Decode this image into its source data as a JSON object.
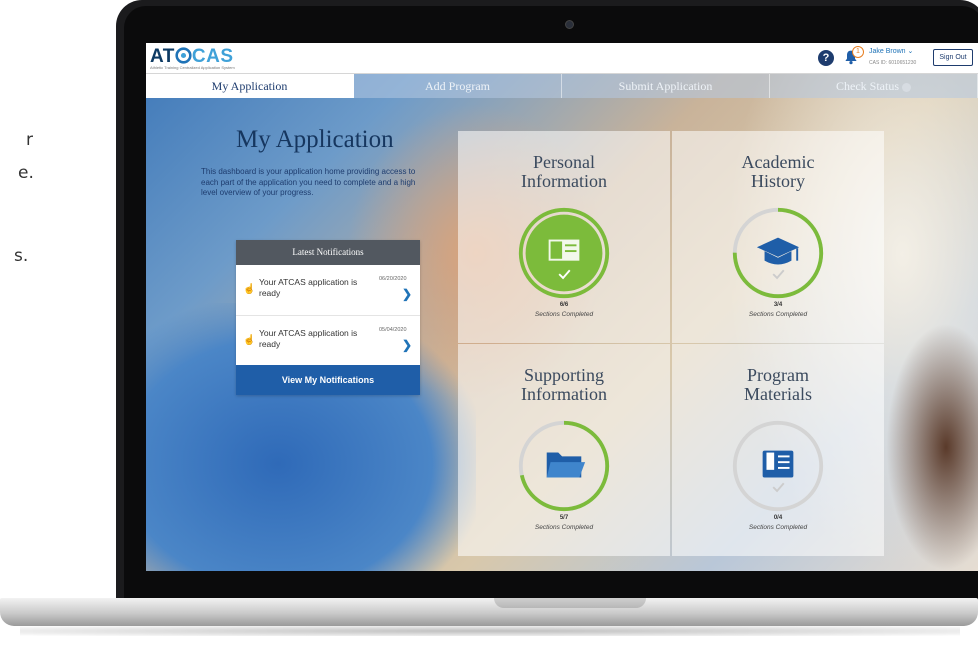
{
  "side_text": [
    "r",
    "e.",
    "s."
  ],
  "header": {
    "logo_prefix": "AT",
    "logo_suffix": "CAS",
    "tagline": "Athletic Training Centralized Application System",
    "help_label": "?",
    "notification_count": "1",
    "user_name": "Jake Brown",
    "user_id": "CAS ID: 6010651230",
    "sign_out": "Sign Out"
  },
  "tabs": [
    {
      "label": "My Application",
      "active": true
    },
    {
      "label": "Add Program"
    },
    {
      "label": "Submit Application"
    },
    {
      "label": "Check Status"
    }
  ],
  "intro": {
    "title": "My Application",
    "description": "This dashboard is your application home providing access to each part of the application you need to complete and a high level overview of your progress."
  },
  "notifications": {
    "header": "Latest Notifications",
    "items": [
      {
        "text": "Your ATCAS application is ready",
        "date": "06/20/2020"
      },
      {
        "text": "Your ATCAS application is ready",
        "date": "05/04/2020"
      }
    ],
    "button": "View My Notifications"
  },
  "sections_label": "Sections Completed",
  "panels": [
    {
      "title_line1": "Personal",
      "title_line2": "Information",
      "completed": 6,
      "total": 6,
      "count": "6/6",
      "icon": "id-card-icon"
    },
    {
      "title_line1": "Academic",
      "title_line2": "History",
      "completed": 3,
      "total": 4,
      "count": "3/4",
      "icon": "graduation-cap-icon"
    },
    {
      "title_line1": "Supporting",
      "title_line2": "Information",
      "completed": 5,
      "total": 7,
      "count": "5/7",
      "icon": "folder-icon"
    },
    {
      "title_line1": "Program",
      "title_line2": "Materials",
      "completed": 0,
      "total": 4,
      "count": "0/4",
      "icon": "book-icon"
    }
  ],
  "colors": {
    "progress": "#7cbb3b",
    "track": "#d4d4d4",
    "navy": "#1e3c6e",
    "button": "#1f5ea8"
  }
}
